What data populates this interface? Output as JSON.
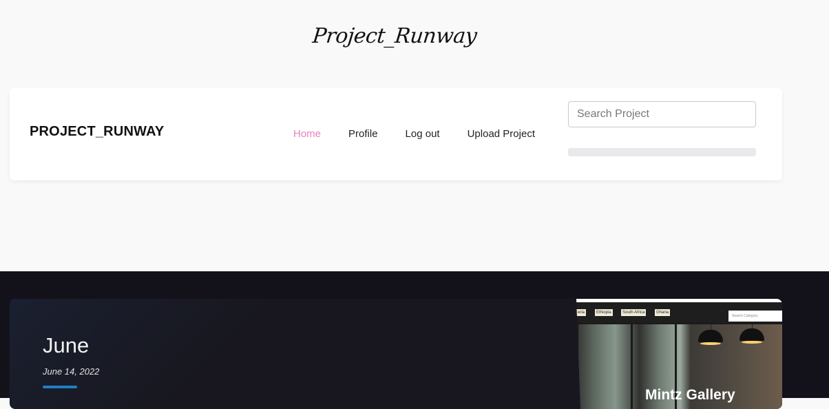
{
  "header": {
    "logo_text": "Project_Runway"
  },
  "navbar": {
    "brand": "PROJECT_RUNWAY",
    "links": [
      {
        "label": "Home",
        "active": true
      },
      {
        "label": "Profile",
        "active": false
      },
      {
        "label": "Log out",
        "active": false
      },
      {
        "label": "Upload Project",
        "active": false
      }
    ],
    "search_placeholder": "Search Project",
    "active_link_color": "#e87fc0"
  },
  "project_card": {
    "title": "June",
    "date": "June 14, 2022",
    "accent_color": "#1f7ec6",
    "preview": {
      "chips": [
        "eria",
        "Ethiopia",
        "South Africa",
        "Ghana"
      ],
      "search_placeholder": "Search Category",
      "title": "Mintz Gallery"
    }
  }
}
